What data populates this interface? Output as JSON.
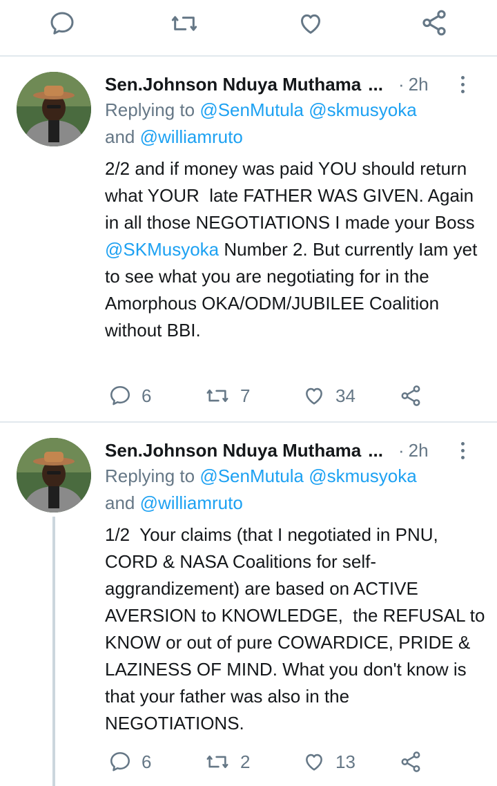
{
  "top_actions": {
    "reply_icon": "reply-icon",
    "retweet_icon": "retweet-icon",
    "like_icon": "heart-icon",
    "share_icon": "share-icon"
  },
  "tweets": [
    {
      "author": "Sen.Johnson Nduya Muthama",
      "ellipsis": "...",
      "dot": "·",
      "time": "2h",
      "reply_prefix": "Replying to",
      "reply_mention_1": "@SenMutula",
      "reply_mention_2": "@skmusyoka",
      "reply_and": "and",
      "reply_mention_3": "@williamruto",
      "body_part_1": "2/2 and if money was paid YOU should return what YOUR  late FATHER WAS GIVEN. Again in all those NEGOTIATIONS I made your Boss ",
      "body_mention": "@SKMusyoka",
      "body_part_2": " Number 2. But currently Iam yet to see what you are negotiating for in the Amorphous OKA/ODM/JUBILEE Coalition without BBI.",
      "replies": "6",
      "retweets": "7",
      "likes": "34"
    },
    {
      "author": "Sen.Johnson Nduya Muthama",
      "ellipsis": "...",
      "dot": "·",
      "time": "2h",
      "reply_prefix": "Replying to",
      "reply_mention_1": "@SenMutula",
      "reply_mention_2": "@skmusyoka",
      "reply_and": "and",
      "reply_mention_3": "@williamruto",
      "body": "1/2  Your claims (that I negotiated in PNU, CORD & NASA Coalitions for self-aggrandizement) are based on ACTIVE AVERSION to KNOWLEDGE,  the REFUSAL to KNOW or out of pure COWARDICE, PRIDE & LAZINESS OF MIND. What you don't know is that your father was also in the NEGOTIATIONS.",
      "replies": "6",
      "retweets": "2",
      "likes": "13"
    }
  ],
  "colors": {
    "link": "#1da1f2",
    "muted": "#657786",
    "divider": "#e1e8ed",
    "thread": "#ccd6dd"
  }
}
